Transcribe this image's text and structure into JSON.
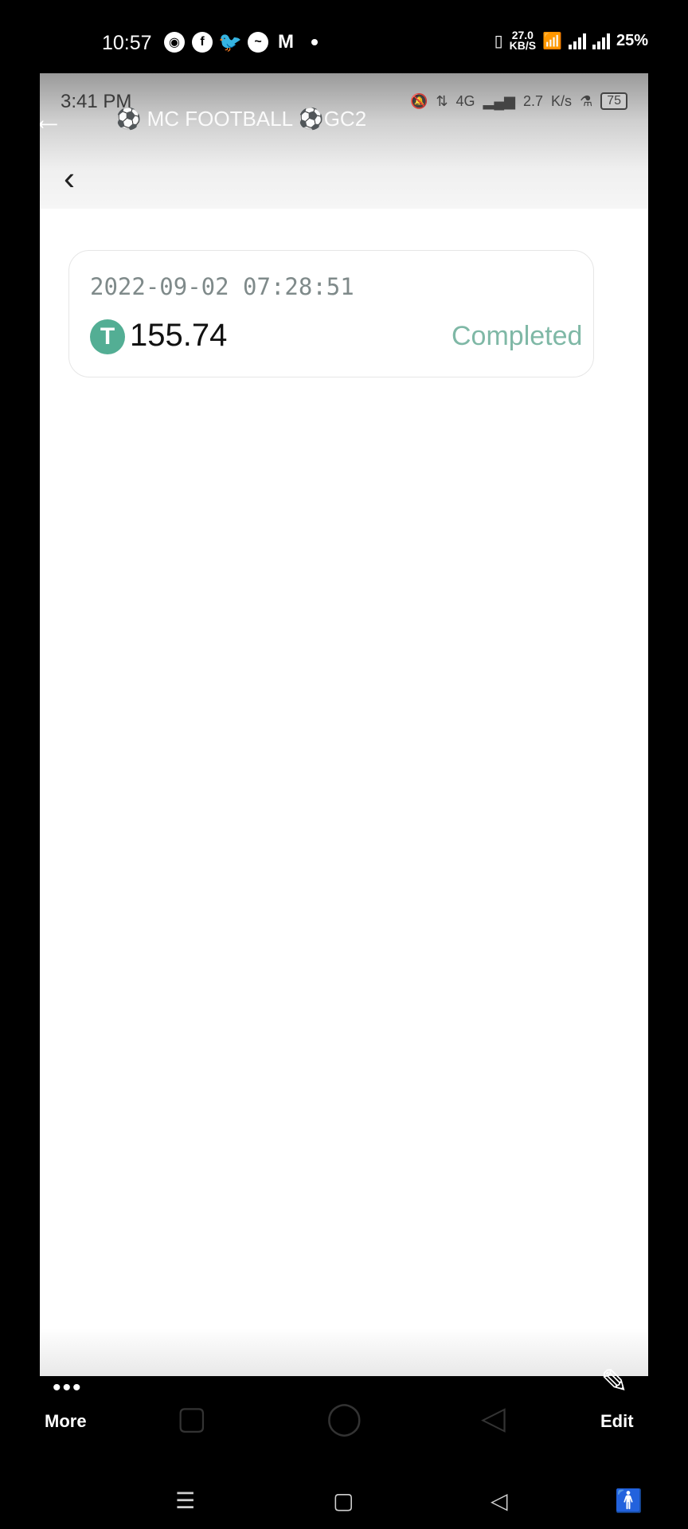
{
  "status_bar": {
    "time": "10:57",
    "net_speed": "27.0",
    "net_unit": "KB/S",
    "battery": "25%"
  },
  "inner_status": {
    "time": "3:41 PM",
    "net": "4G",
    "speed": "2.7",
    "speed_unit": "K/s",
    "battery": "75"
  },
  "chat": {
    "title": "⚽ MC FOOTBALL ⚽GC2"
  },
  "transaction": {
    "datetime": "2022-09-02 07:28:51",
    "coin_symbol": "T",
    "amount": "155.74",
    "status": "Completed"
  },
  "bottom_bar": {
    "more_label": "More",
    "edit_label": "Edit"
  },
  "colors": {
    "tether": "#53ae94",
    "status": "#7fb8a6"
  }
}
